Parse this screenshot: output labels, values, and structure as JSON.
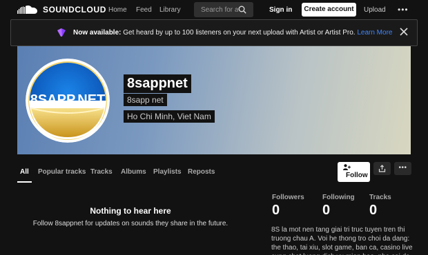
{
  "brand": {
    "name": "SOUNDCLOUD"
  },
  "nav": {
    "home": "Home",
    "feed": "Feed",
    "library": "Library"
  },
  "search": {
    "placeholder": "Search for artists, bands, tracks, podcasts"
  },
  "header_actions": {
    "sign_in": "Sign in",
    "create_account": "Create account",
    "upload": "Upload"
  },
  "banner": {
    "bold": "Now available:",
    "text": " Get heard by up to 100 listeners on your next upload with Artist or Artist Pro. ",
    "link": "Learn More"
  },
  "profile": {
    "avatar_text": "8SAPP.NET",
    "name": "8sappnet",
    "subtitle": "8sapp net",
    "location": "Ho Chi Minh, Viet Nam"
  },
  "tabs": [
    "All",
    "Popular tracks",
    "Tracks",
    "Albums",
    "Playlists",
    "Reposts"
  ],
  "actions": {
    "follow": "Follow"
  },
  "empty": {
    "title": "Nothing to hear here",
    "subtitle": "Follow 8sappnet for updates on sounds they share in the future."
  },
  "stats": {
    "followers_label": "Followers",
    "followers": "0",
    "following_label": "Following",
    "following": "0",
    "tracks_label": "Tracks",
    "tracks": "0"
  },
  "bio": "8S la mot nen tang giai tri truc tuyen tren thi truong chau A. Voi he thong tro choi da dang: the thao, tai xiu, slot game, ban ca, casino live cung chat luong dich vu mien bao, nha cai da va dang"
}
